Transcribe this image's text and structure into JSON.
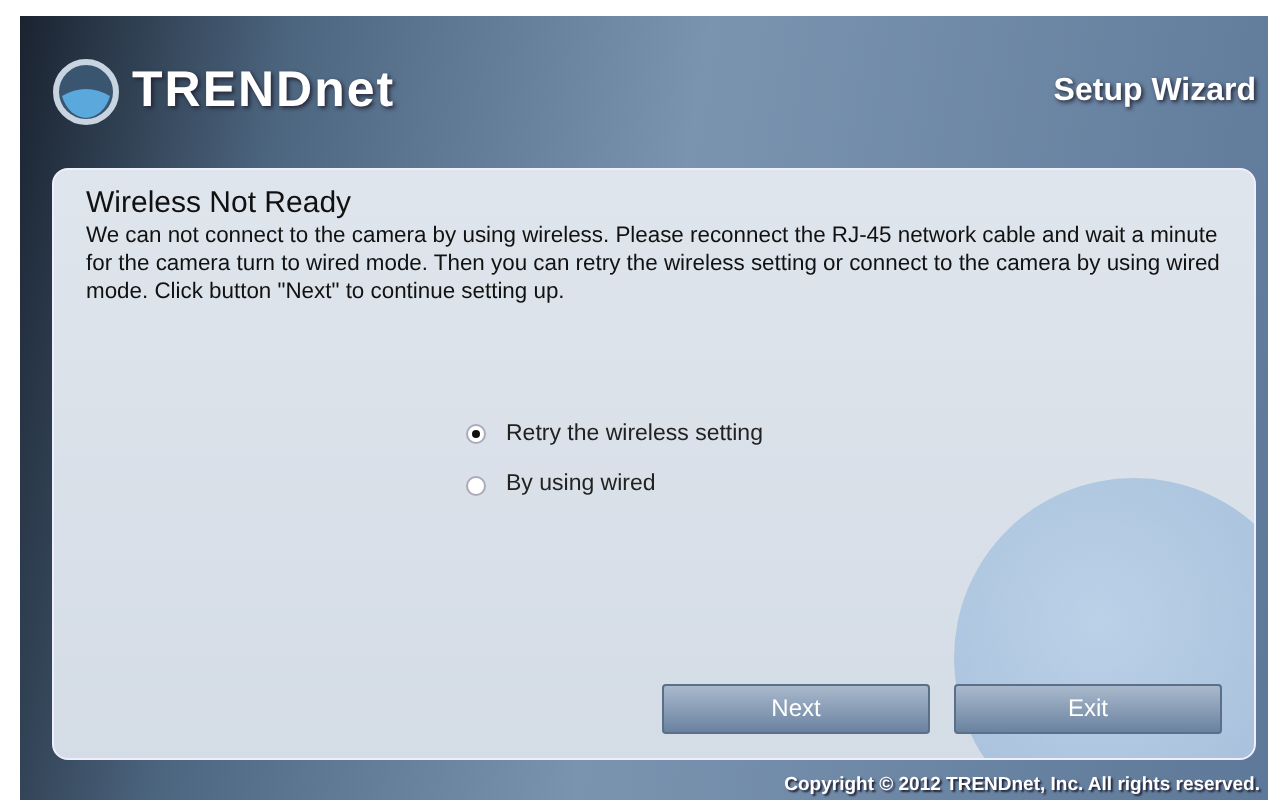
{
  "header": {
    "logo": "TRENDnet",
    "title": "Setup Wizard"
  },
  "panel": {
    "heading": "Wireless Not Ready",
    "message": "We can not connect to the camera by using wireless. Please reconnect the RJ-45 network cable and wait a minute for the camera turn to wired mode. Then you can retry the wireless setting or connect to the camera by using wired mode. Click button \"Next\" to continue setting up.",
    "options": [
      {
        "label": "Retry the wireless setting",
        "selected": true
      },
      {
        "label": "By using wired",
        "selected": false
      }
    ],
    "buttons": [
      "Next",
      "Exit"
    ]
  },
  "footer": "Copyright © 2012 TRENDnet, Inc. All rights reserved."
}
